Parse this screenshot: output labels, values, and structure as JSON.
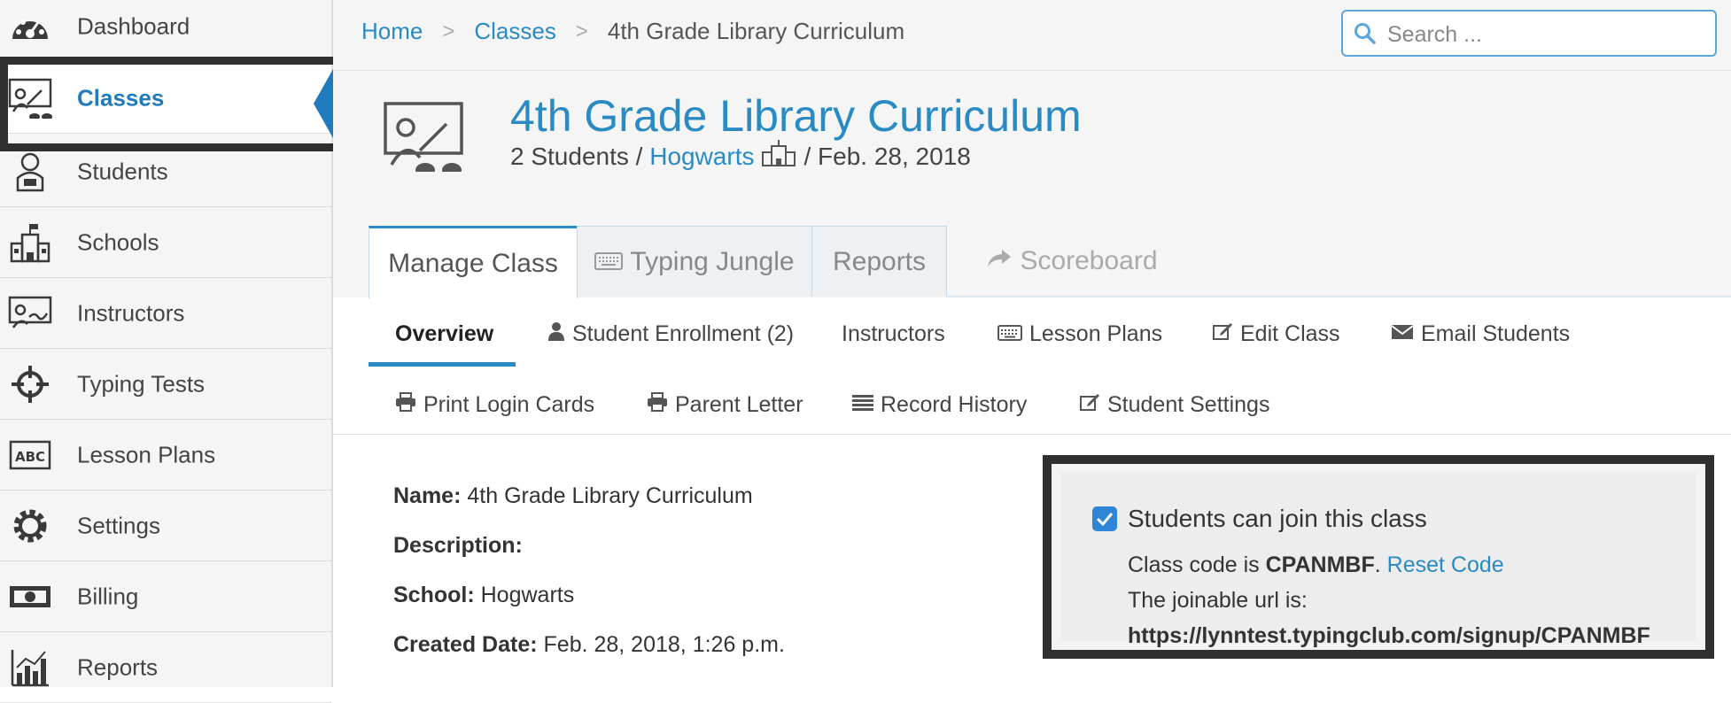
{
  "sidebar": {
    "items": [
      {
        "label": "Dashboard",
        "icon": "dashboard-gauge-icon"
      },
      {
        "label": "Classes",
        "icon": "classroom-teacher-icon",
        "active": true
      },
      {
        "label": "Students",
        "icon": "student-icon"
      },
      {
        "label": "Schools",
        "icon": "school-building-icon"
      },
      {
        "label": "Instructors",
        "icon": "instructor-board-icon"
      },
      {
        "label": "Typing Tests",
        "icon": "crosshair-icon"
      },
      {
        "label": "Lesson Plans",
        "icon": "abc-icon"
      },
      {
        "label": "Settings",
        "icon": "gear-icon"
      },
      {
        "label": "Billing",
        "icon": "money-icon"
      },
      {
        "label": "Reports",
        "icon": "bar-chart-icon"
      }
    ]
  },
  "breadcrumb": {
    "home": "Home",
    "classes": "Classes",
    "current": "4th Grade Library Curriculum",
    "separator": ">"
  },
  "search": {
    "placeholder": "Search ..."
  },
  "class_header": {
    "title": "4th Grade Library Curriculum",
    "students": "2 Students /",
    "school": "Hogwarts",
    "date": "/ Feb. 28, 2018"
  },
  "tabs": [
    {
      "label": "Manage Class",
      "active": true
    },
    {
      "label": "Typing Jungle",
      "icon": "keyboard-icon"
    },
    {
      "label": "Reports"
    },
    {
      "label": "Scoreboard",
      "icon": "share-arrow-icon"
    }
  ],
  "subnav": {
    "overview": "Overview",
    "student_enrollment": "Student Enrollment (2)",
    "instructors": "Instructors",
    "lesson_plans": "Lesson Plans",
    "edit_class": "Edit Class",
    "email_students": "Email Students",
    "print_login_cards": "Print Login Cards",
    "parent_letter": "Parent Letter",
    "record_history": "Record History",
    "student_settings": "Student Settings"
  },
  "details": {
    "name_label": "Name:",
    "name_value": "4th Grade Library Curriculum",
    "description_label": "Description:",
    "school_label": "School:",
    "school_value": "Hogwarts",
    "created_label": "Created Date:",
    "created_value": "Feb. 28, 2018, 1:26 p.m."
  },
  "join_panel": {
    "checkbox_label": "Students can join this class",
    "checked": true,
    "code_prefix": "Class code is",
    "code": "CPANMBF",
    "code_suffix": ".",
    "reset_link": "Reset Code",
    "url_label": "The joinable url is:",
    "url": "https://lynntest.typingclub.com/signup/CPANMBF"
  },
  "colors": {
    "accent": "#2a8ac4",
    "active_sidebar_text": "#1f7bbd",
    "highlight_frame": "#2f2f2f",
    "checkbox": "#2f86d6"
  }
}
